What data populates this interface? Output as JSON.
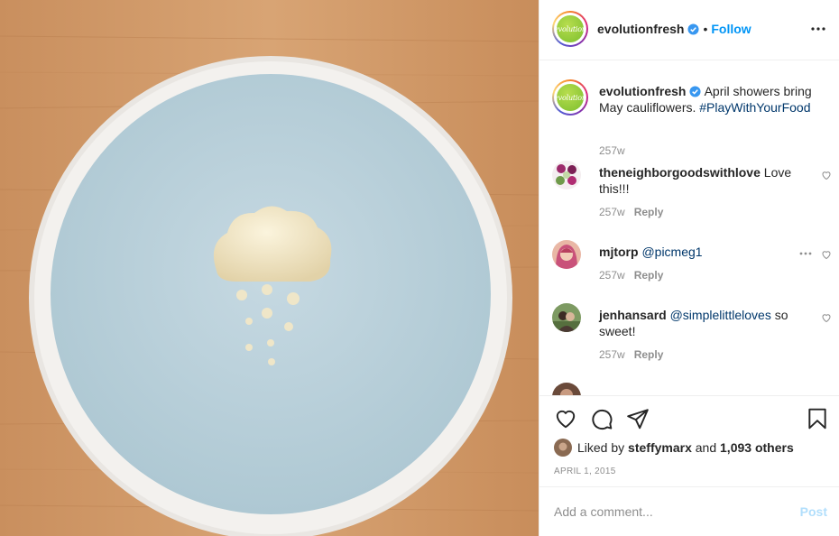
{
  "post": {
    "username": "evolutionfresh",
    "logo_text": "evolution",
    "follow_label": "Follow",
    "separator": "•",
    "caption_text": "April showers bring May cauliflowers.",
    "caption_hashtag": "#PlayWithYourFood",
    "caption_time": "257w"
  },
  "comments": [
    {
      "username": "theneighborgoodswithlove",
      "text": "Love this!!!",
      "mention": "",
      "time": "257w",
      "reply": "Reply"
    },
    {
      "username": "mjtorp",
      "text": "",
      "mention": "@picmeg1",
      "time": "257w",
      "reply": "Reply"
    },
    {
      "username": "jenhansard",
      "text": "so sweet!",
      "mention": "@simplelittleloves",
      "time": "257w",
      "reply": "Reply"
    }
  ],
  "likes": {
    "prefix": "Liked by",
    "user": "steffymarx",
    "conj": "and",
    "others": "1,093 others"
  },
  "date": "APRIL 1, 2015",
  "add_comment": {
    "placeholder": "Add a comment...",
    "post_label": "Post"
  },
  "icons": [
    "more-horizontal-icon",
    "verified-badge-icon",
    "heart-icon",
    "comment-icon",
    "share-icon",
    "bookmark-icon"
  ],
  "colors": {
    "link": "#0095f6",
    "hashtag": "#00376b",
    "muted": "#8e8e8e",
    "post_disabled": "#b2dffc"
  }
}
